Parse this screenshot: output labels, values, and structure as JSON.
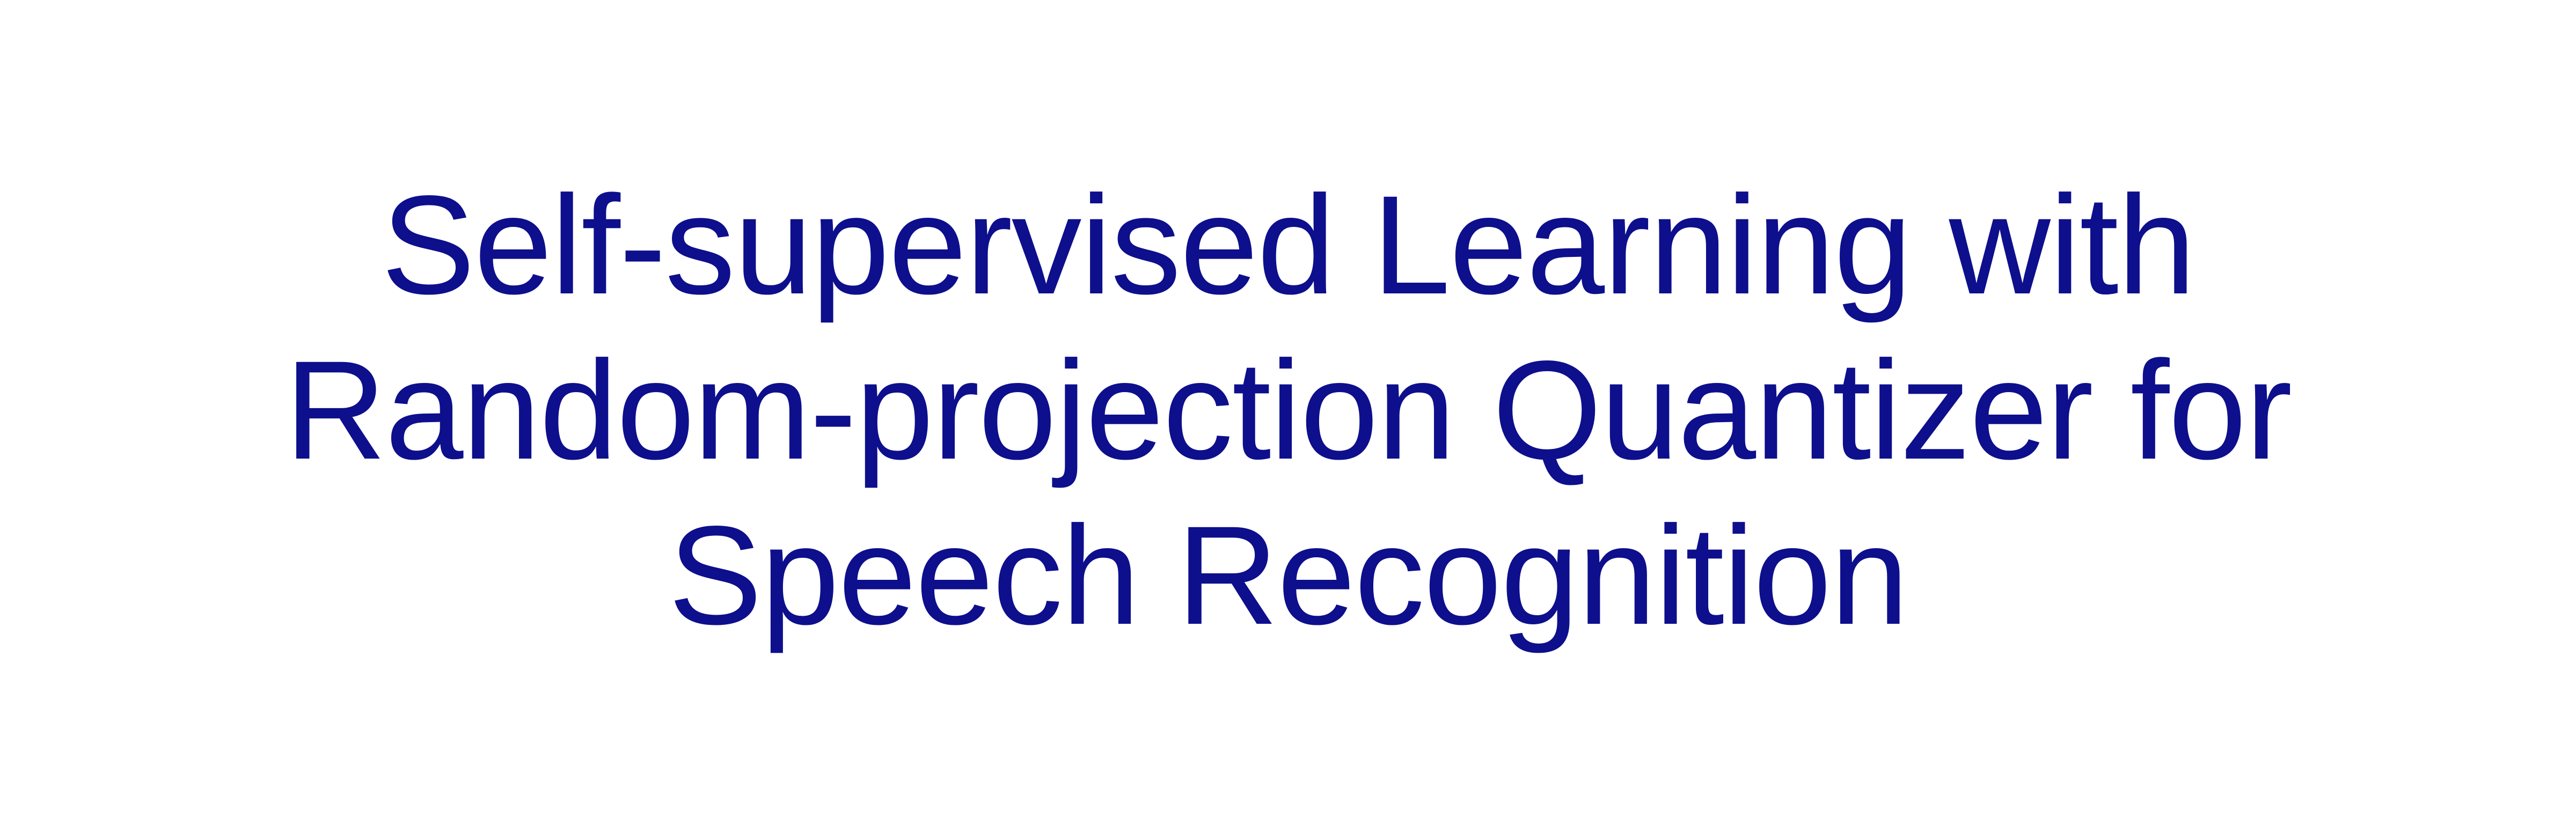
{
  "title": {
    "lines": [
      "Self-supervised Learning with",
      "Random-projection Quantizer for",
      "Speech Recognition"
    ]
  },
  "colors": {
    "background": "#ffffff",
    "text": "#0d0f8c"
  }
}
